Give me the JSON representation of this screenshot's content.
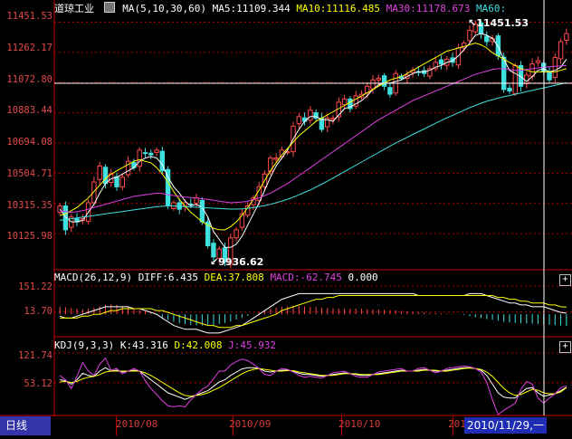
{
  "header": {
    "index_name": "道琼工业",
    "ma_label": "MA(5,10,30,60)",
    "ma5": "MA5:11109.344",
    "ma10": "MA10:11116.485",
    "ma30": "MA30:11178.673",
    "ma60": "MA60:"
  },
  "macd_header": {
    "params": "MACD(26,12,9)",
    "diff": "DIFF:6.435",
    "dea": "DEA:37.808",
    "macd": "MACD:-62.745",
    "zero": "0.000"
  },
  "kdj_header": {
    "params": "KDJ(9,3,3)",
    "k": "K:43.316",
    "d": "D:42.008",
    "j": "J:45.932"
  },
  "price_axis": [
    "11451.53",
    "11262.17",
    "11072.80",
    "10883.44",
    "10694.08",
    "10504.71",
    "10315.35",
    "10125.98"
  ],
  "macd_axis": [
    "151.22",
    "13.70"
  ],
  "kdj_axis": [
    "121.74",
    "53.12"
  ],
  "months": [
    "2010/08",
    "2010/09",
    "2010/10",
    "201"
  ],
  "cursor_date": "2010/11/29,一",
  "period_tab": "日线",
  "max_label": "11451.53",
  "min_label": "9936.62",
  "colors": {
    "up": "#ff4a4a",
    "down": "#3fe0e0",
    "ma5": "#ffffff",
    "ma10": "#ffff00",
    "ma30": "#e040e0",
    "ma60": "#40e0e0",
    "grid": "#aa0000",
    "axis": "#cc0000"
  },
  "chart_data": [
    {
      "type": "candlestick",
      "title": "道琼工业",
      "ylim": [
        9900,
        11500
      ],
      "closes": [
        10300,
        10150,
        10230,
        10200,
        10220,
        10320,
        10450,
        10550,
        10440,
        10500,
        10420,
        10480,
        10580,
        10540,
        10650,
        10630,
        10620,
        10650,
        10520,
        10300,
        10320,
        10280,
        10320,
        10310,
        10350,
        10200,
        10050,
        9980,
        10030,
        9950,
        10100,
        10150,
        10250,
        10300,
        10350,
        10420,
        10500,
        10600,
        10600,
        10650,
        10640,
        10800,
        10860,
        10830,
        10900,
        10850,
        10780,
        10850,
        10850,
        10950,
        10970,
        10910,
        10990,
        11000,
        11050,
        11090,
        11100,
        11050,
        11000,
        11130,
        11100,
        11120,
        11150,
        11140,
        11130,
        11160,
        11200,
        11190,
        11220,
        11200,
        11290,
        11320,
        11400,
        11440,
        11380,
        11330,
        11350,
        11240,
        11030,
        11020,
        11180,
        11050,
        11120,
        11190,
        11210,
        11140,
        11090,
        11230,
        11330,
        11380
      ],
      "ma5": [
        10280,
        10230,
        10200,
        10200,
        10210,
        10260,
        10310,
        10380,
        10440,
        10470,
        10480,
        10500,
        10520,
        10540,
        10580,
        10600,
        10610,
        10600,
        10560,
        10480,
        10420,
        10380,
        10330,
        10300,
        10310,
        10290,
        10230,
        10140,
        10090,
        10040,
        10040,
        10060,
        10110,
        10180,
        10250,
        10320,
        10400,
        10480,
        10550,
        10600,
        10650,
        10720,
        10780,
        10830,
        10860,
        10860,
        10840,
        10840,
        10830,
        10870,
        10910,
        10920,
        10940,
        10960,
        10990,
        11030,
        11060,
        11070,
        11070,
        11080,
        11090,
        11110,
        11130,
        11140,
        11140,
        11150,
        11170,
        11180,
        11200,
        11210,
        11240,
        11280,
        11320,
        11370,
        11380,
        11370,
        11350,
        11300,
        11220,
        11150,
        11130,
        11110,
        11080,
        11110,
        11150,
        11160,
        11140,
        11150,
        11170,
        11220
      ],
      "ma10": [
        10240,
        10250,
        10270,
        10290,
        10320,
        10350,
        10390,
        10430,
        10470,
        10500,
        10520,
        10540,
        10560,
        10580,
        10590,
        10580,
        10570,
        10540,
        10500,
        10450,
        10390,
        10340,
        10300,
        10260,
        10230,
        10200,
        10180,
        10160,
        10150,
        10150,
        10170,
        10200,
        10240,
        10290,
        10340,
        10400,
        10460,
        10520,
        10570,
        10620,
        10660,
        10700,
        10740,
        10770,
        10800,
        10830,
        10850,
        10870,
        10890,
        10910,
        10930,
        10950,
        10970,
        10990,
        11010,
        11030,
        11050,
        11070,
        11090,
        11100,
        11110,
        11130,
        11150,
        11170,
        11190,
        11210,
        11230,
        11250,
        11270,
        11280,
        11290,
        11300,
        11310,
        11320,
        11310,
        11290,
        11260,
        11240,
        11220,
        11200,
        11180,
        11160,
        11150,
        11140,
        11140,
        11140,
        11140,
        11140,
        11150,
        11160
      ],
      "ma30": [
        10270,
        10265,
        10260,
        10265,
        10270,
        10280,
        10290,
        10300,
        10310,
        10320,
        10330,
        10340,
        10350,
        10360,
        10365,
        10370,
        10375,
        10380,
        10378,
        10370,
        10365,
        10360,
        10355,
        10352,
        10350,
        10345,
        10340,
        10335,
        10330,
        10325,
        10320,
        10322,
        10325,
        10330,
        10340,
        10350,
        10365,
        10380,
        10400,
        10420,
        10440,
        10465,
        10490,
        10515,
        10540,
        10565,
        10590,
        10615,
        10640,
        10665,
        10690,
        10715,
        10740,
        10765,
        10790,
        10815,
        10840,
        10860,
        10880,
        10900,
        10920,
        10940,
        10960,
        10975,
        10990,
        11005,
        11020,
        11035,
        11050,
        11065,
        11080,
        11095,
        11110,
        11125,
        11135,
        11145,
        11155,
        11160,
        11160,
        11155,
        11150,
        11150,
        11155,
        11160,
        11165,
        11170,
        11172,
        11175,
        11178,
        11180
      ],
      "ma60": [
        10210,
        10215,
        10220,
        10225,
        10230,
        10235,
        10240,
        10245,
        10250,
        10255,
        10260,
        10265,
        10270,
        10275,
        10280,
        10285,
        10290,
        10295,
        10298,
        10300,
        10300,
        10298,
        10296,
        10294,
        10292,
        10290,
        10288,
        10286,
        10284,
        10282,
        10280,
        10280,
        10282,
        10285,
        10290,
        10296,
        10302,
        10310,
        10320,
        10330,
        10342,
        10355,
        10370,
        10385,
        10400,
        10418,
        10436,
        10455,
        10475,
        10495,
        10515,
        10535,
        10555,
        10575,
        10595,
        10615,
        10635,
        10655,
        10675,
        10695,
        10712,
        10730,
        10748,
        10765,
        10782,
        10800,
        10818,
        10835,
        10852,
        10868,
        10884,
        10900,
        10916,
        10930,
        10944,
        10956,
        10966,
        10976,
        10984,
        10992,
        11000,
        11008,
        11016,
        11024,
        11032,
        11040,
        11048,
        11056,
        11064,
        11072
      ]
    },
    {
      "type": "bar",
      "title": "MACD(26,12,9)",
      "ylim": [
        -110,
        170
      ],
      "macd": [
        40,
        38,
        34,
        30,
        26,
        30,
        36,
        44,
        50,
        54,
        50,
        44,
        38,
        30,
        22,
        14,
        6,
        -4,
        -16,
        -30,
        -40,
        -48,
        -52,
        -56,
        -58,
        -60,
        -60,
        -56,
        -52,
        -46,
        -38,
        -28,
        -18,
        -8,
        2,
        12,
        22,
        30,
        36,
        40,
        42,
        44,
        44,
        42,
        40,
        38,
        36,
        34,
        32,
        30,
        30,
        30,
        30,
        30,
        28,
        26,
        26,
        24,
        22,
        20,
        18,
        16,
        14,
        12,
        10,
        8,
        8,
        6,
        4,
        2,
        0,
        -4,
        -10,
        -16,
        -20,
        -26,
        -30,
        -34,
        -40,
        -44,
        -46,
        -48,
        -48,
        -50,
        -52,
        -54,
        -56,
        -58,
        -60,
        -62
      ],
      "diff": [
        -10,
        -20,
        -20,
        -10,
        0,
        10,
        20,
        30,
        40,
        40,
        40,
        40,
        40,
        30,
        30,
        20,
        10,
        0,
        -20,
        -40,
        -60,
        -70,
        -80,
        -80,
        -80,
        -90,
        -100,
        -100,
        -100,
        -90,
        -80,
        -70,
        -60,
        -40,
        -20,
        0,
        20,
        40,
        60,
        80,
        90,
        100,
        110,
        110,
        110,
        110,
        110,
        110,
        110,
        110,
        110,
        110,
        110,
        110,
        110,
        110,
        110,
        110,
        110,
        110,
        110,
        110,
        110,
        100,
        100,
        100,
        100,
        100,
        100,
        100,
        100,
        100,
        110,
        110,
        110,
        100,
        90,
        80,
        70,
        60,
        60,
        50,
        50,
        40,
        40,
        40,
        30,
        20,
        10,
        6
      ],
      "dea": [
        -20,
        -20,
        -20,
        -20,
        -10,
        -10,
        0,
        0,
        10,
        20,
        20,
        30,
        30,
        30,
        30,
        30,
        30,
        20,
        20,
        10,
        0,
        -10,
        -20,
        -30,
        -40,
        -50,
        -60,
        -60,
        -70,
        -70,
        -70,
        -60,
        -60,
        -50,
        -40,
        -30,
        -20,
        -10,
        0,
        20,
        30,
        40,
        50,
        60,
        70,
        80,
        80,
        90,
        90,
        100,
        100,
        100,
        100,
        100,
        100,
        100,
        100,
        100,
        100,
        100,
        100,
        100,
        100,
        100,
        100,
        100,
        100,
        100,
        100,
        100,
        100,
        100,
        100,
        100,
        100,
        100,
        100,
        90,
        90,
        80,
        80,
        70,
        70,
        60,
        60,
        60,
        50,
        50,
        40,
        38
      ]
    },
    {
      "type": "line",
      "title": "KDJ(9,3,3)",
      "ylim": [
        -20,
        130
      ],
      "k": [
        60,
        58,
        50,
        60,
        75,
        70,
        68,
        80,
        88,
        80,
        82,
        78,
        80,
        82,
        80,
        70,
        60,
        50,
        40,
        30,
        25,
        20,
        15,
        20,
        25,
        30,
        35,
        45,
        55,
        60,
        70,
        78,
        85,
        88,
        88,
        86,
        80,
        78,
        80,
        82,
        82,
        80,
        75,
        72,
        72,
        70,
        68,
        70,
        72,
        74,
        76,
        74,
        72,
        70,
        70,
        72,
        74,
        76,
        78,
        80,
        82,
        80,
        80,
        82,
        84,
        82,
        80,
        80,
        82,
        84,
        86,
        88,
        88,
        86,
        82,
        70,
        50,
        30,
        20,
        18,
        18,
        30,
        40,
        42,
        30,
        22,
        25,
        28,
        35,
        43
      ],
      "d": [
        55,
        56,
        54,
        56,
        62,
        66,
        68,
        72,
        78,
        80,
        80,
        80,
        80,
        80,
        80,
        76,
        70,
        62,
        54,
        46,
        38,
        30,
        24,
        22,
        24,
        26,
        30,
        36,
        42,
        50,
        58,
        66,
        74,
        80,
        84,
        86,
        84,
        82,
        80,
        80,
        81,
        81,
        78,
        76,
        74,
        72,
        70,
        70,
        70,
        72,
        74,
        74,
        74,
        72,
        72,
        72,
        72,
        74,
        76,
        78,
        80,
        80,
        80,
        80,
        82,
        82,
        82,
        80,
        80,
        82,
        84,
        86,
        87,
        86,
        84,
        78,
        68,
        54,
        40,
        30,
        24,
        26,
        32,
        38,
        36,
        30,
        28,
        28,
        32,
        42
      ],
      "j": [
        70,
        60,
        40,
        68,
        100,
        80,
        70,
        96,
        110,
        82,
        86,
        74,
        80,
        86,
        80,
        58,
        40,
        26,
        12,
        0,
        -2,
        0,
        -2,
        14,
        26,
        38,
        46,
        62,
        80,
        80,
        94,
        102,
        108,
        104,
        96,
        86,
        72,
        70,
        80,
        86,
        84,
        78,
        70,
        66,
        68,
        66,
        64,
        70,
        76,
        78,
        80,
        74,
        68,
        66,
        66,
        72,
        78,
        80,
        82,
        84,
        86,
        80,
        80,
        86,
        88,
        82,
        76,
        80,
        86,
        88,
        90,
        92,
        90,
        86,
        78,
        54,
        14,
        -20,
        -10,
        -2,
        6,
        38,
        56,
        50,
        18,
        6,
        18,
        28,
        42,
        46
      ]
    }
  ]
}
